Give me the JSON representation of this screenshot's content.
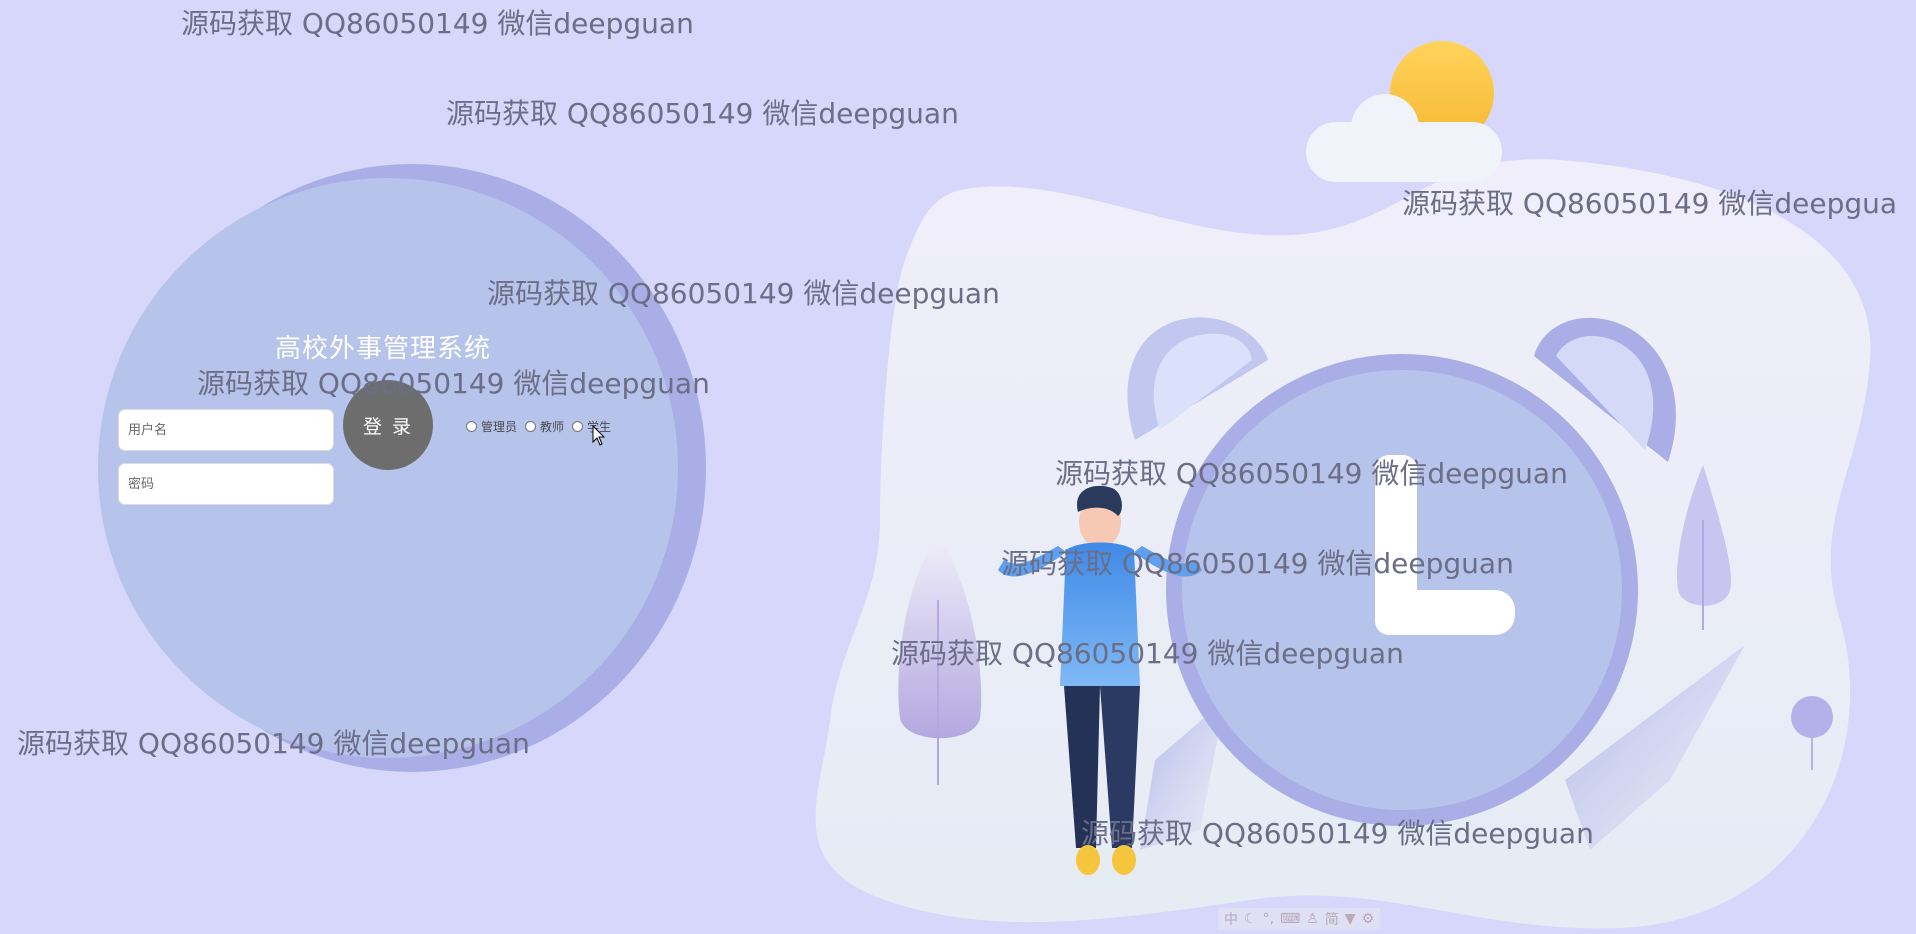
{
  "login": {
    "title": "高校外事管理系统",
    "username_placeholder": "用户名",
    "password_placeholder": "密码",
    "login_button": "登 录",
    "roles": [
      "管理员",
      "教师",
      "学生"
    ]
  },
  "watermark_text": "源码获取 QQ86050149 微信deepguan",
  "watermarks": [
    "源码获取 QQ86050149 微信deepguan",
    "源码获取 QQ86050149 微信deepguan",
    "源码获取 QQ86050149 微信deepgua",
    "源码获取 QQ86050149 微信deepguan",
    "源码获取 QQ86050149 微信deepguan",
    "源码获取 QQ86050149 微信deepguan",
    "源码获取 QQ86050149 微信deepguan",
    "源码获取 QQ86050149 微信deepguan",
    "源码获取 QQ86050149 微信deepguan",
    "源码获取 QQ86050149 微信deepguan"
  ],
  "ime_bar": [
    "中",
    "简"
  ],
  "colors": {
    "background": "#d6d7fb",
    "circle": "#b6c3ea",
    "circle_shadow": "#a9aee6",
    "login_button": "#6d6d6d",
    "watermark": "#6b6e86"
  },
  "icons": [
    "sun-icon",
    "cloud-icon",
    "alarm-clock-illustration",
    "person-illustration",
    "tree-icon",
    "radio-icon",
    "cursor-icon"
  ]
}
